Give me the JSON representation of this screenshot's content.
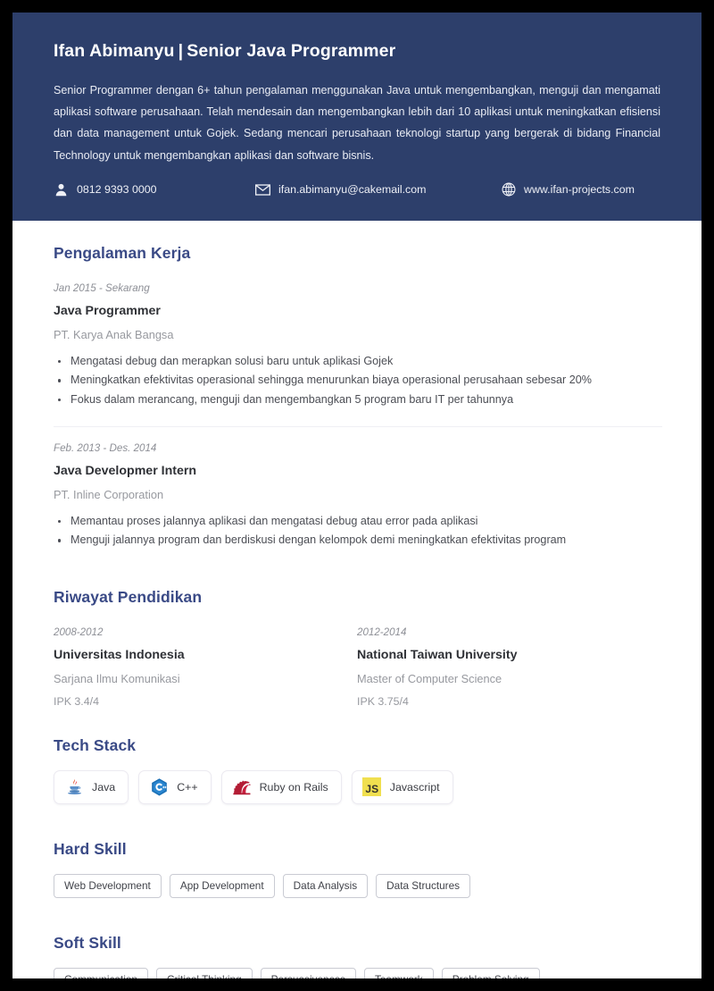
{
  "theme": {
    "header_bg": "#2d3f6b",
    "heading_color": "#3a4a86",
    "page_bg": "#ffffff",
    "outer_bg": "#000000",
    "muted_text": "#97999f",
    "body_text": "#4c4e55"
  },
  "header": {
    "name": "Ifan Abimanyu",
    "separator": "|",
    "job_title": "Senior Java Programmer",
    "summary": "Senior Programmer dengan 6+ tahun pengalaman menggunakan Java untuk mengembangkan, menguji dan mengamati aplikasi software perusahaan. Telah mendesain dan mengembangkan lebih dari 10 aplikasi untuk meningkatkan efisiensi dan data management untuk Gojek. Sedang mencari perusahaan teknologi startup yang bergerak di bidang Financial Technology untuk mengembangkan aplikasi dan software bisnis.",
    "contacts": [
      {
        "icon": "person-icon",
        "value": "0812 9393 0000"
      },
      {
        "icon": "envelope-icon",
        "value": "ifan.abimanyu@cakemail.com"
      },
      {
        "icon": "globe-icon",
        "value": "www.ifan-projects.com"
      }
    ]
  },
  "experience": {
    "title": "Pengalaman Kerja",
    "entries": [
      {
        "date": "Jan 2015 - Sekarang",
        "role": "Java Programmer",
        "company": "PT. Karya Anak Bangsa",
        "bullets": [
          "Mengatasi debug dan merapkan solusi baru untuk aplikasi Gojek",
          "Meningkatkan efektivitas operasional sehingga menurunkan biaya operasional perusahaan sebesar 20%",
          "Fokus dalam merancang, menguji dan mengembangkan 5 program baru IT per tahunnya"
        ]
      },
      {
        "date": "Feb. 2013 - Des. 2014",
        "role": "Java Developmer Intern",
        "company": "PT. Inline Corporation",
        "bullets": [
          "Memantau proses jalannya aplikasi dan mengatasi debug atau error pada aplikasi",
          "Menguji jalannya program dan berdiskusi dengan kelompok demi meningkatkan efektivitas program"
        ]
      }
    ]
  },
  "education": {
    "title": "Riwayat Pendidikan",
    "entries": [
      {
        "date": "2008-2012",
        "school": "Universitas Indonesia",
        "degree": "Sarjana Ilmu Komunikasi",
        "gpa": "IPK 3.4/4"
      },
      {
        "date": "2012-2014",
        "school": "National Taiwan University",
        "degree": "Master of Computer Science",
        "gpa": "IPK 3.75/4"
      }
    ]
  },
  "tech_stack": {
    "title": "Tech Stack",
    "items": [
      {
        "label": "Java",
        "icon": "java-coffee-cup-icon"
      },
      {
        "label": "C++",
        "icon": "cpp-hexagon-icon"
      },
      {
        "label": "Ruby on Rails",
        "icon": "rails-icon"
      },
      {
        "label": "Javascript",
        "icon": "javascript-badge-icon",
        "badge_text": "JS"
      }
    ]
  },
  "hard_skill": {
    "title": "Hard Skill",
    "tags": [
      "Web Development",
      "App Development",
      "Data Analysis",
      "Data Structures"
    ]
  },
  "soft_skill": {
    "title": "Soft Skill",
    "tags": [
      "Communication",
      "Critical Thinking",
      "Persuasiveness",
      "Teamwork",
      "Problem Solving"
    ]
  }
}
